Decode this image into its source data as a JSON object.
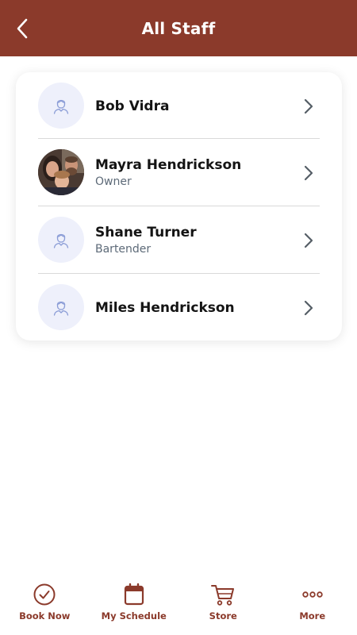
{
  "header": {
    "title": "All Staff"
  },
  "staff": [
    {
      "name": "Bob Vidra",
      "role": ""
    },
    {
      "name": "Mayra Hendrickson",
      "role": "Owner"
    },
    {
      "name": "Shane Turner",
      "role": "Bartender"
    },
    {
      "name": "Miles Hendrickson",
      "role": ""
    }
  ],
  "tabs": [
    {
      "label": "Book Now",
      "icon": "check-circle-icon"
    },
    {
      "label": "My Schedule",
      "icon": "calendar-icon"
    },
    {
      "label": "Store",
      "icon": "cart-icon"
    },
    {
      "label": "More",
      "icon": "more-dots-icon"
    }
  ],
  "colors": {
    "brand": "#8b3a2b",
    "avatar_bg": "#eef0fb",
    "avatar_icon": "#8a9cd6"
  }
}
